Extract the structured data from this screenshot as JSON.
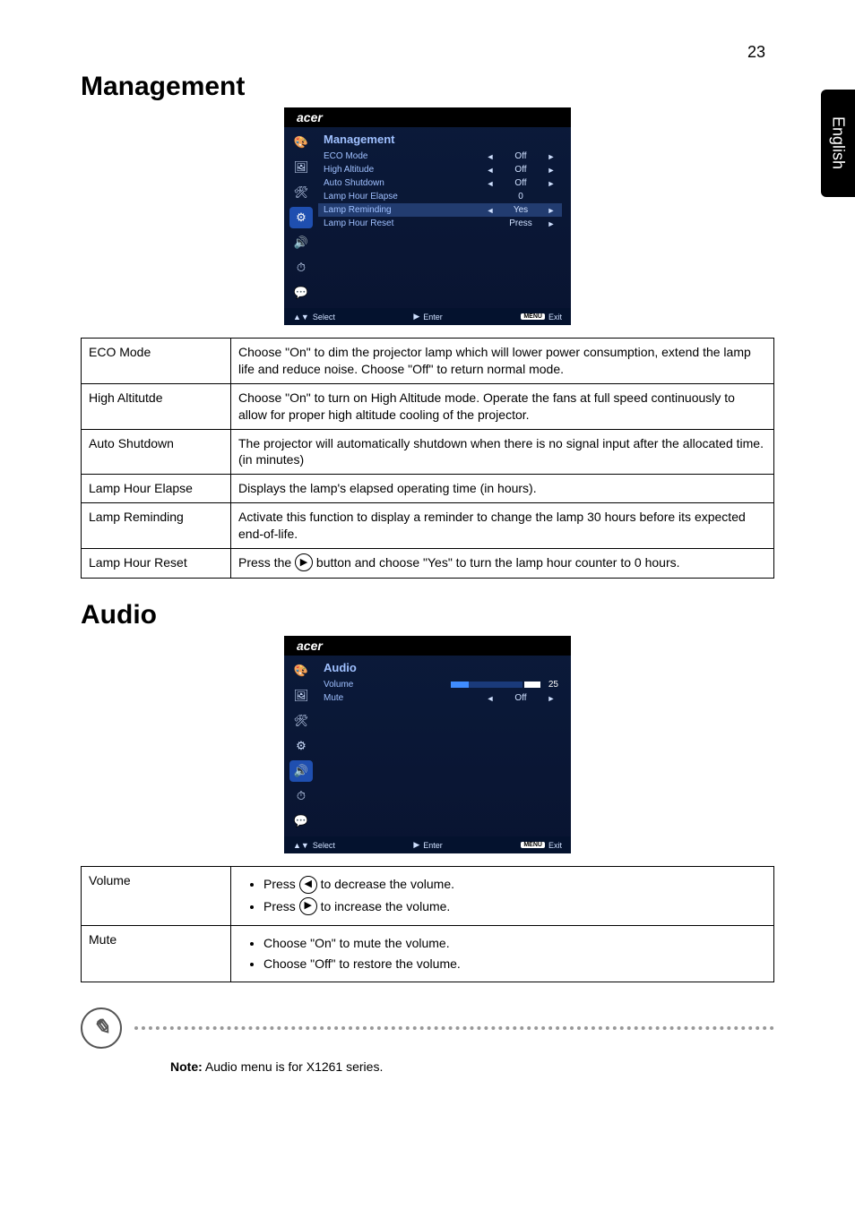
{
  "page_number": "23",
  "side_tab": "English",
  "sections": {
    "management": {
      "heading": "Management",
      "osd": {
        "brand": "acer",
        "title": "Management",
        "rows": [
          {
            "label": "ECO Mode",
            "left": "◄",
            "value": "Off",
            "right": "►"
          },
          {
            "label": "High Altitude",
            "left": "◄",
            "value": "Off",
            "right": "►"
          },
          {
            "label": "Auto Shutdown",
            "left": "◄",
            "value": "Off",
            "right": "►"
          },
          {
            "label": "Lamp Hour Elapse",
            "left": "",
            "value": "0",
            "right": ""
          },
          {
            "label": "Lamp Reminding",
            "left": "◄",
            "value": "Yes",
            "right": "►",
            "hl": true
          },
          {
            "label": "Lamp Hour Reset",
            "left": "",
            "value": "Press",
            "right": "►"
          }
        ],
        "footer": {
          "select": "Select",
          "enter": "Enter",
          "menu_badge": "MENU",
          "exit": "Exit"
        }
      },
      "table": [
        {
          "k": "ECO Mode",
          "v": "Choose \"On\" to dim the projector lamp which will lower power consumption, extend the lamp life and reduce noise. Choose \"Off\" to return normal mode."
        },
        {
          "k": "High Altitutde",
          "v": "Choose \"On\" to turn on High Altitude mode. Operate the fans at full speed continuously to allow for proper high altitude cooling of the projector."
        },
        {
          "k": "Auto Shutdown",
          "v": "The projector will automatically shutdown when there is no signal input after the allocated time. (in minutes)"
        },
        {
          "k": "Lamp Hour Elapse",
          "v": "Displays the lamp's elapsed operating time (in hours)."
        },
        {
          "k": "Lamp Reminding",
          "v": "Activate this function to display a reminder to change the lamp 30 hours before its expected end-of-life."
        }
      ],
      "lamp_reset": {
        "k": "Lamp Hour Reset",
        "pre": "Press the ",
        "icon": "▶",
        "post": " button and choose \"Yes\" to turn the lamp hour counter to 0 hours."
      }
    },
    "audio": {
      "heading": "Audio",
      "osd": {
        "brand": "acer",
        "title": "Audio",
        "rows": [
          {
            "label": "Volume",
            "type": "bar",
            "num": "25"
          },
          {
            "label": "Mute",
            "left": "◄",
            "value": "Off",
            "right": "►"
          }
        ],
        "footer": {
          "select": "Select",
          "enter": "Enter",
          "menu_badge": "MENU",
          "exit": "Exit"
        }
      },
      "volume": {
        "k": "Volume",
        "line1_pre": "Press ",
        "line1_icon": "◀",
        "line1_post": " to decrease the volume.",
        "line2_pre": "Press ",
        "line2_icon": "▶",
        "line2_post": " to increase the volume."
      },
      "mute": {
        "k": "Mute",
        "line1": "Choose \"On\" to mute the volume.",
        "line2": "Choose \"Off\" to restore the volume."
      }
    }
  },
  "note": {
    "label": "Note:",
    "text": " Audio menu is for X1261 series."
  },
  "osd_common": {
    "up_down": "▲▼",
    "right_tri": "▶"
  }
}
